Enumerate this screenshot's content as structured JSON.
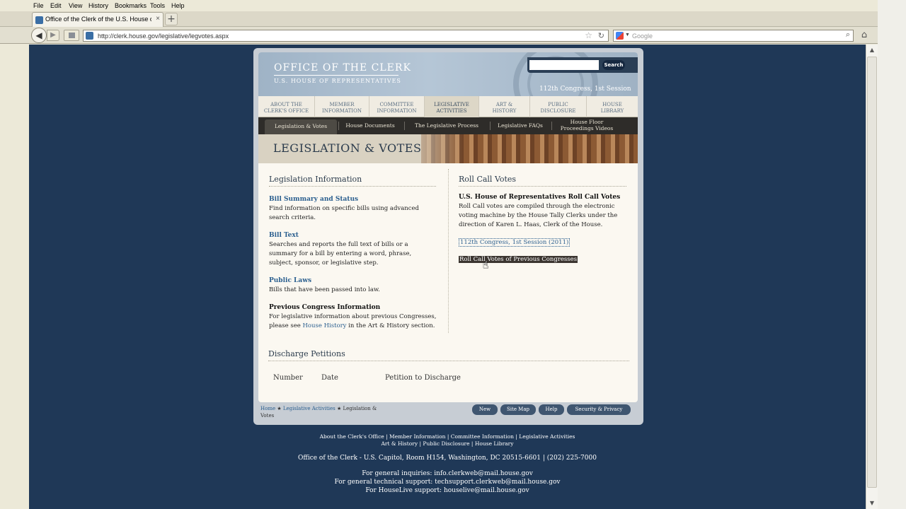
{
  "browser": {
    "menu": [
      "File",
      "Edit",
      "View",
      "History",
      "Bookmarks",
      "Tools",
      "Help"
    ],
    "tab_title": "Office of the Clerk of the U.S. House of Rep...",
    "tab_close": "×",
    "new_tab": "+",
    "url": "http://clerk.house.gov/legislative/legvotes.aspx",
    "search_placeholder": "Google"
  },
  "header": {
    "office": "OFFICE OF THE CLERK",
    "house": "U.S. HOUSE OF REPRESENTATIVES",
    "congress": "112th Congress, 1st Session",
    "search_button": "Search"
  },
  "main_nav": [
    {
      "l1": "About the",
      "l2": "Clerk's Office"
    },
    {
      "l1": "Member",
      "l2": "Information"
    },
    {
      "l1": "Committee",
      "l2": "Information"
    },
    {
      "l1": "Legislative",
      "l2": "Activities"
    },
    {
      "l1": "Art &",
      "l2": "History"
    },
    {
      "l1": "Public",
      "l2": "Disclosure"
    },
    {
      "l1": "House",
      "l2": "Library"
    }
  ],
  "sub_nav": [
    {
      "l1": "Legislation & Votes",
      "l2": ""
    },
    {
      "l1": "House Documents",
      "l2": ""
    },
    {
      "l1": "The Legislative Process",
      "l2": ""
    },
    {
      "l1": "Legislative FAQs",
      "l2": ""
    },
    {
      "l1": "House Floor",
      "l2": "Proceedings Videos"
    }
  ],
  "banner_title": "LEGISLATION & VOTES",
  "left": {
    "heading": "Legislation Information",
    "items": [
      {
        "title": "Bill Summary and Status",
        "lines": [
          "Find information on specific bills using advanced",
          "search criteria."
        ]
      },
      {
        "title": "Bill Text",
        "lines": [
          "Searches and reports the full text of bills or a",
          "summary for a bill by entering a word, phrase,",
          "subject, sponsor, or legislative step."
        ]
      },
      {
        "title": "Public Laws",
        "lines": [
          "Bills that have been passed into law."
        ]
      }
    ],
    "prev_title": "Previous Congress Information",
    "prev_line1": "For legislative information about previous Congresses,",
    "prev_line2_a": "please see ",
    "prev_line2_link": "House History",
    "prev_line2_b": " in the Art & History section."
  },
  "right": {
    "heading": "Roll Call Votes",
    "subtitle": "U.S. House of Representatives Roll Call Votes",
    "lines": [
      "Roll Call votes are compiled through the electronic",
      "voting machine by the House Tally Clerks under the",
      "direction of Karen L. Haas, Clerk of the House."
    ],
    "link1": "112th Congress, 1st Session (2011)",
    "link2": "Roll Call Votes of Previous Congresses"
  },
  "discharge": {
    "heading": "Discharge Petitions",
    "columns": [
      "Number",
      "Date",
      "Petition to Discharge"
    ]
  },
  "footer_bar": {
    "breadcrumb_home": "Home",
    "breadcrumb_sep": " ★ ",
    "breadcrumb_mid": "Legislative Activities",
    "breadcrumb_current": "Legislation & Votes",
    "buttons": [
      "New",
      "Site Map",
      "Help",
      "Security & Privacy"
    ]
  },
  "site_footer": {
    "links1": "About the Clerk's Office | Member Information | Committee Information | Legislative Activities",
    "links2": "Art & History | Public Disclosure | House Library",
    "address": "Office of the Clerk - U.S. Capitol, Room H154, Washington, DC 20515-6601 | (202) 225-7000",
    "inq1": "For general inquiries: info.clerkweb@mail.house.gov",
    "inq2": "For general technical support: techsupport.clerkweb@mail.house.gov",
    "inq3": "For HouseLive support: houselive@mail.house.gov"
  }
}
